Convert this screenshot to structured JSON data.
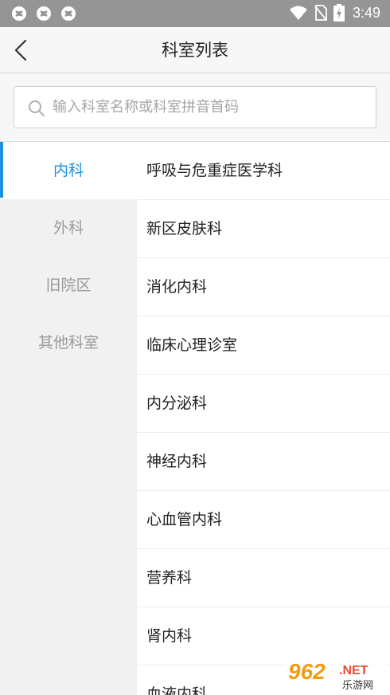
{
  "status_bar": {
    "time": "3:49",
    "left_icons": [
      "notification-icon",
      "notification-icon",
      "notification-icon"
    ],
    "right_icons": [
      "wifi-icon",
      "no-sim-icon",
      "battery-charging-icon"
    ]
  },
  "header": {
    "title": "科室列表",
    "back_icon": "chevron-left-icon"
  },
  "search": {
    "placeholder": "输入科室名称或科室拼音首码",
    "value": ""
  },
  "categories": [
    {
      "label": "内科",
      "active": true
    },
    {
      "label": "外科",
      "active": false
    },
    {
      "label": "旧院区",
      "active": false
    },
    {
      "label": "其他科室",
      "active": false
    }
  ],
  "departments": [
    "呼吸与危重症医学科",
    "新区皮肤科",
    "消化内科",
    "临床心理诊室",
    "内分泌科",
    "神经内科",
    "心血管内科",
    "营养科",
    "肾内科",
    "血液内科"
  ],
  "watermark": {
    "brand_number": "962",
    "brand_suffix": ".NET",
    "site_name": "乐游网"
  },
  "colors": {
    "accent": "#1e90e0",
    "status_bar": "#959595",
    "sidebar_bg": "#f1f1f1",
    "header_bg": "#f7f7f7"
  }
}
